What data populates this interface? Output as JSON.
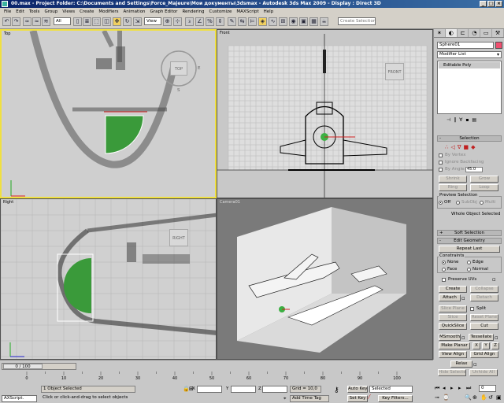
{
  "window": {
    "title": "00.max    - Project Folder: C:\\Documents and Settings\\Force_Majeure\\Мои документы\\3dsmax    - Autodesk 3ds Max  2009        - Display : Direct 3D"
  },
  "menu": [
    "File",
    "Edit",
    "Tools",
    "Group",
    "Views",
    "Create",
    "Modifiers",
    "Animation",
    "Graph Editor",
    "Rendering",
    "Customize",
    "MAXScript",
    "Help"
  ],
  "toolbar": {
    "filter": "All",
    "ref_coord": "View",
    "selection_set_placeholder": "Create Selection Set"
  },
  "viewports": {
    "top": {
      "label": "Top",
      "cube": "TOP",
      "e": "E",
      "s": "S"
    },
    "front": {
      "label": "Front",
      "cube": "FRONT"
    },
    "right": {
      "label": "Right",
      "cube": "RIGHT"
    },
    "camera": {
      "label": "Camera01"
    }
  },
  "command_panel": {
    "object_name": "Sphere01",
    "object_color": "#f05070",
    "modifier_list": "Modifier List",
    "stack_item": "Editable Poly",
    "selection": {
      "title": "Selection",
      "by_vertex": "By Vertex",
      "ignore_backfacing": "Ignore Backfacing",
      "by_angle": "By Angle:",
      "by_angle_value": "45.0",
      "shrink": "Shrink",
      "grow": "Grow",
      "ring": "Ring",
      "loop": "Loop",
      "preview_selection": "Preview Selection",
      "off": "Off",
      "subobj": "SubObj",
      "multi": "Multi",
      "status": "Whole Object Selected"
    },
    "soft_selection": "Soft Selection",
    "edit_geometry": {
      "title": "Edit Geometry",
      "repeat_last": "Repeat Last",
      "constraints": "Constraints",
      "none": "None",
      "edge": "Edge",
      "face": "Face",
      "normal": "Normal",
      "preserve_uvs": "Preserve UVs",
      "create": "Create",
      "collapse": "Collapse",
      "attach": "Attach",
      "detach": "Detach",
      "slice_plane": "Slice Plane",
      "split": "Split",
      "slice": "Slice",
      "reset_plane": "Reset Plane",
      "quickslice": "QuickSlice",
      "cut": "Cut",
      "msmooth": "MSmooth",
      "tessellate": "Tessellate",
      "make_planar": "Make Planar",
      "x": "X",
      "y": "Y",
      "z": "Z",
      "view_align": "View Align",
      "grid_align": "Grid Align",
      "relax": "Relax",
      "hide_selected": "Hide Selected",
      "unhide_all": "Unhide All"
    }
  },
  "timeline": {
    "frame": "0 / 100",
    "ticks": [
      "0",
      "10",
      "20",
      "30",
      "40",
      "50",
      "60",
      "70",
      "80",
      "90",
      "100"
    ]
  },
  "status": {
    "maxscript": "AXScript.",
    "objects_selected": "1 Object Selected",
    "prompt": "Click or click-and-drag to select objects",
    "x_label": "X",
    "y_label": "Y",
    "z_label": "Z",
    "grid": "Grid = 10,0",
    "add_time_tag": "Add Time Tag",
    "auto_key": "Auto Key",
    "selected": "Selected",
    "set_key": "Set Key",
    "key_filters": "Key Filters...",
    "frame_field": "0"
  }
}
